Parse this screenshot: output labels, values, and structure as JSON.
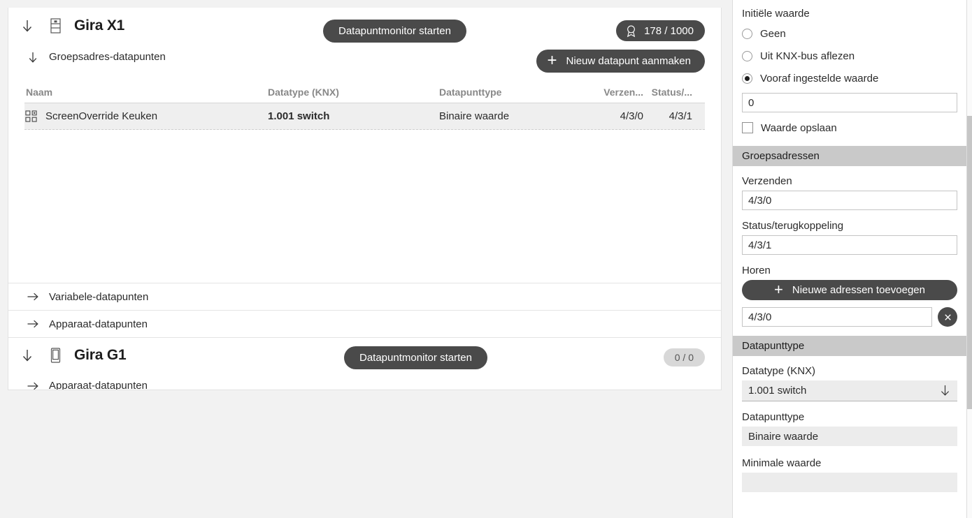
{
  "main": {
    "devices": [
      {
        "title": "Gira X1",
        "icon": "din-rail-device-icon",
        "collapse_icon": "arrow-down-icon",
        "monitor_button": "Datapuntmonitor starten",
        "counter": "178 / 1000",
        "counter_icon": "award-ribbon-icon",
        "new_datapoint_button": "Nieuw datapunt aanmaken",
        "groups": [
          {
            "label": "Groepsadres-datapunten",
            "icon": "arrow-down-icon",
            "expanded": true
          },
          {
            "label": "Variabele-datapunten",
            "icon": "arrow-right-icon",
            "expanded": false
          },
          {
            "label": "Apparaat-datapunten",
            "icon": "arrow-right-icon",
            "expanded": false
          }
        ],
        "table": {
          "columns": [
            "Naam",
            "Datatype (KNX)",
            "Datapunttype",
            "Verzen...",
            "Status/..."
          ],
          "rows": [
            {
              "icon": "datapoint-grid-icon",
              "naam": "ScreenOverride Keuken",
              "datatype": "1.001 switch",
              "datapunttype": "Binaire waarde",
              "verzenden": "4/3/0",
              "status": "4/3/1"
            }
          ]
        }
      },
      {
        "title": "Gira G1",
        "icon": "tablet-device-icon",
        "collapse_icon": "arrow-down-icon",
        "monitor_button": "Datapuntmonitor starten",
        "counter": "0 / 0",
        "groups": [
          {
            "label": "Apparaat-datapunten",
            "icon": "arrow-right-icon",
            "expanded": false
          }
        ]
      }
    ]
  },
  "sidebar": {
    "initial_value": {
      "heading": "Initiële waarde",
      "options": [
        {
          "label": "Geen",
          "selected": false
        },
        {
          "label": "Uit KNX-bus aflezen",
          "selected": false
        },
        {
          "label": "Vooraf ingestelde waarde",
          "selected": true
        }
      ],
      "value": "0",
      "save_value_label": "Waarde opslaan",
      "save_value_checked": false
    },
    "group_addresses": {
      "heading": "Groepsadressen",
      "send_label": "Verzenden",
      "send_value": "4/3/0",
      "status_label": "Status/terugkoppeling",
      "status_value": "4/3/1",
      "listen_label": "Horen",
      "add_button": "Nieuwe adressen toevoegen",
      "listen_value": "4/3/0",
      "delete_icon": "close-circle-icon"
    },
    "datapoint_type": {
      "heading": "Datapunttype",
      "knx_label": "Datatype (KNX)",
      "knx_value": "1.001 switch",
      "knx_caret_icon": "arrow-down-icon",
      "dpt_label": "Datapunttype",
      "dpt_value": "Binaire waarde",
      "min_label": "Minimale waarde"
    }
  },
  "colors": {
    "accent_dark": "#4a4a4a",
    "section_header": "#c9c9c9",
    "row_highlight": "#efefef",
    "page_bg": "#f2f2f2"
  }
}
